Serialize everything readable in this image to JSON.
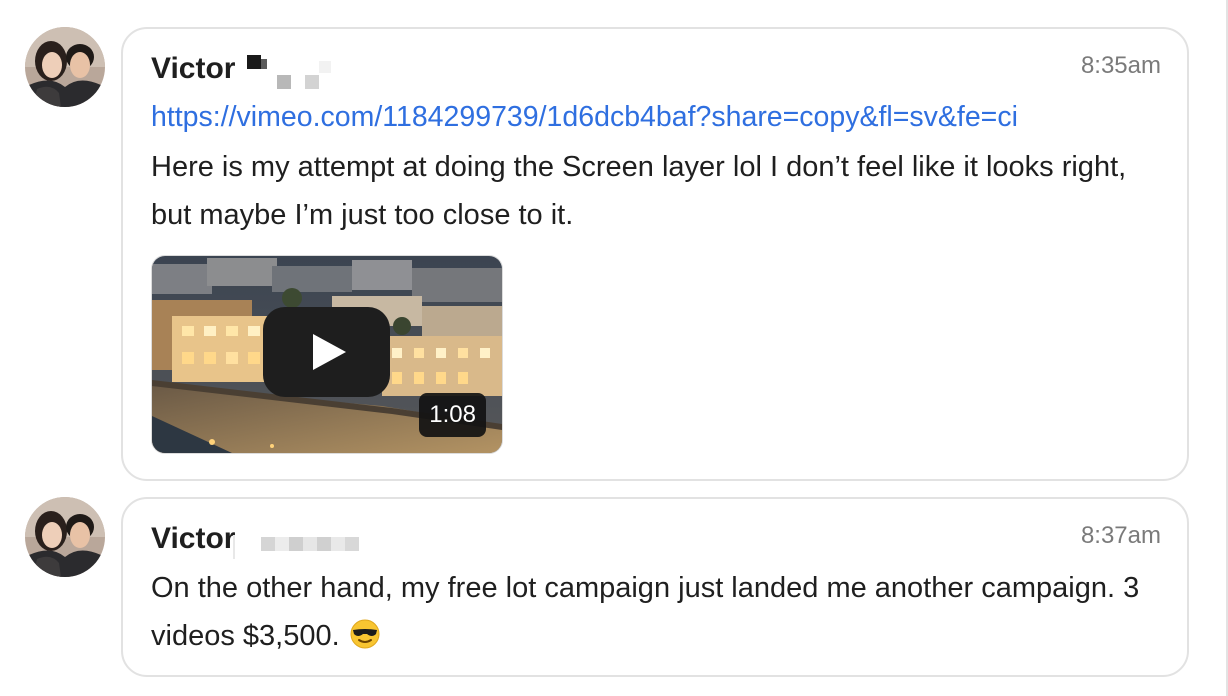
{
  "messages": [
    {
      "author": "Victor",
      "time": "8:35am",
      "link": "https://vimeo.com/1184299739/1d6dcb4baf?share=copy&fl=sv&fe=ci",
      "text": "Here is my attempt at doing the Screen layer lol I don’t feel like it looks right, but maybe I’m just too close to it.",
      "video": {
        "duration": "1:08",
        "play_icon": "play-icon"
      }
    },
    {
      "author": "Victor",
      "time": "8:37am",
      "text": "On the other hand, my free lot campaign just landed me another campaign. 3 videos $3,500.",
      "emoji": "smiling-face-with-sunglasses"
    }
  ],
  "colors": {
    "link": "#2f6fe0",
    "text": "#1f1f1f",
    "timestamp": "#7a7a7a",
    "bubble_border": "#e2e2e2"
  }
}
